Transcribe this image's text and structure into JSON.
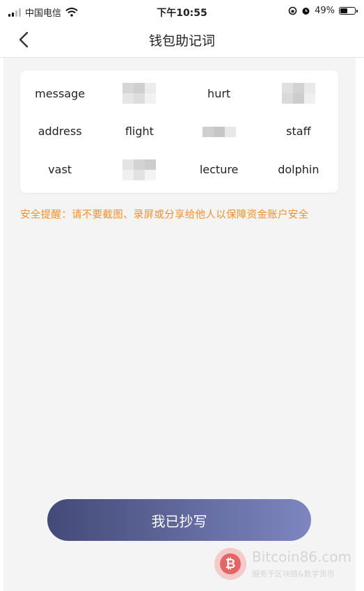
{
  "status_bar": {
    "carrier": "中国电信",
    "time": "下午10:55",
    "battery_percent": "49%",
    "battery_level": 0.49
  },
  "nav": {
    "title": "钱包助记词"
  },
  "mnemonic": {
    "rows": [
      [
        "message",
        "",
        "hurt",
        ""
      ],
      [
        "address",
        "flight",
        "",
        "staff"
      ],
      [
        "vast",
        "",
        "lecture",
        "dolphin"
      ]
    ]
  },
  "warning": "安全提醒：请不要截图、录屏或分享给他人以保障资金账户安全",
  "confirm_button": "我已抄写",
  "watermark": {
    "brand": "Bitcoin86.com",
    "tagline": "服务于区块链&数字货币",
    "logo_letter": "₿"
  }
}
